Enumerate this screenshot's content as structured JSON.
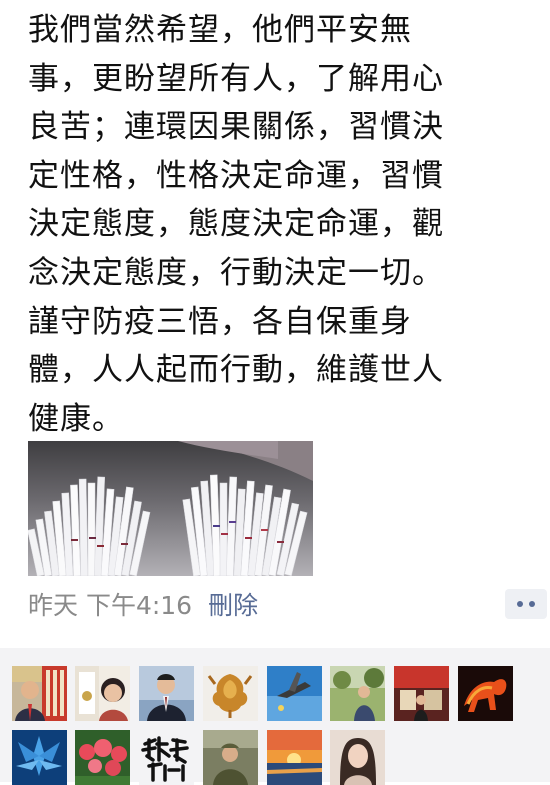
{
  "post": {
    "text": "我們當然希望，他們平安無\n事，更盼望所有人，了解用心\n良苦；連環因果關係，習慣決\n定性格，性格決定命運，習慣\n決定態度，態度決定命運，觀\n念決定態度，行動決定一切。\n謹守防疫三悟，各自保重身\n體，人人起而行動，維護世人\n健康。",
    "image_icon": "rapid-test-strips-photo",
    "timestamp": "昨天 下午4:16",
    "delete_label": "刪除",
    "more_icon": "more-dots-icon"
  },
  "likes": {
    "avatars": [
      {
        "name": "avatar-1"
      },
      {
        "name": "avatar-2"
      },
      {
        "name": "avatar-3"
      },
      {
        "name": "avatar-4"
      },
      {
        "name": "avatar-5"
      },
      {
        "name": "avatar-6"
      },
      {
        "name": "avatar-7"
      },
      {
        "name": "avatar-8"
      },
      {
        "name": "avatar-9"
      },
      {
        "name": "avatar-10"
      },
      {
        "name": "avatar-11"
      },
      {
        "name": "avatar-12"
      },
      {
        "name": "avatar-13"
      },
      {
        "name": "avatar-14"
      }
    ]
  },
  "colors": {
    "link": "#576b95",
    "meta_text": "#8a8a8a",
    "body_text": "#111111",
    "likes_bg": "#f3f3f5"
  }
}
